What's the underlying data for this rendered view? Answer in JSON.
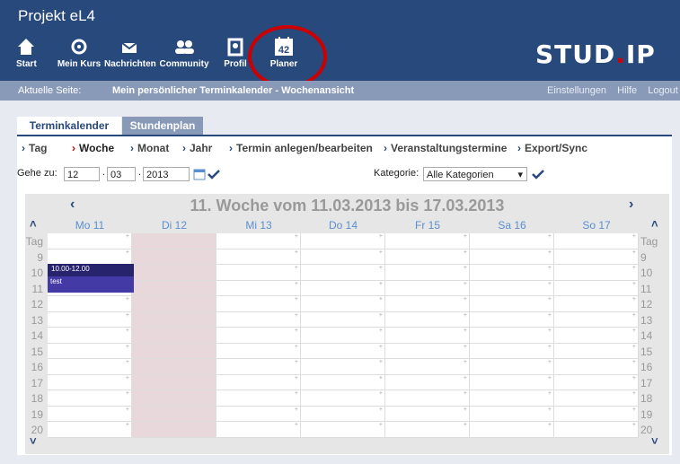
{
  "app_title": "Projekt eL4",
  "logo": {
    "part1": "STUD",
    "dot": ".",
    "part2": "IP"
  },
  "nav": [
    {
      "label": "Start",
      "icon": "home-icon"
    },
    {
      "label": "Mein Kurs",
      "icon": "course-icon"
    },
    {
      "label": "Nachrichten",
      "icon": "mail-icon"
    },
    {
      "label": "Community",
      "icon": "community-icon"
    },
    {
      "label": "Profil",
      "icon": "profile-icon"
    },
    {
      "label": "Planer",
      "icon": "calendar-icon",
      "badge": "42"
    }
  ],
  "breadcrumb": {
    "label": "Aktuelle Seite:",
    "page": "Mein persönlicher Terminkalender - Wochenansicht",
    "links": [
      "Einstellungen",
      "Hilfe",
      "Logout"
    ]
  },
  "tabs": [
    "Terminkalender",
    "Stundenplan"
  ],
  "views": [
    "Tag",
    "Woche",
    "Monat",
    "Jahr",
    "Termin anlegen/bearbeiten",
    "Veranstaltungstermine",
    "Export/Sync"
  ],
  "goto": {
    "label": "Gehe zu:",
    "day": "12",
    "month": "03",
    "year": "2013"
  },
  "category": {
    "label": "Kategorie:",
    "value": "Alle Kategorien"
  },
  "week_title": "11. Woche vom 11.03.2013 bis 17.03.2013",
  "days": [
    "Mo 11",
    "Di 12",
    "Mi 13",
    "Do 14",
    "Fr 15",
    "Sa 16",
    "So 17"
  ],
  "rows": [
    "Tag",
    "9",
    "10",
    "11",
    "12",
    "13",
    "14",
    "15",
    "16",
    "17",
    "18",
    "19",
    "20"
  ],
  "event": {
    "time": "10.00-12.00",
    "title": "test"
  },
  "colors": {
    "header": "#28497c",
    "event": "#28236d",
    "today": "#e9d8db",
    "highlight": "#cc0000"
  }
}
